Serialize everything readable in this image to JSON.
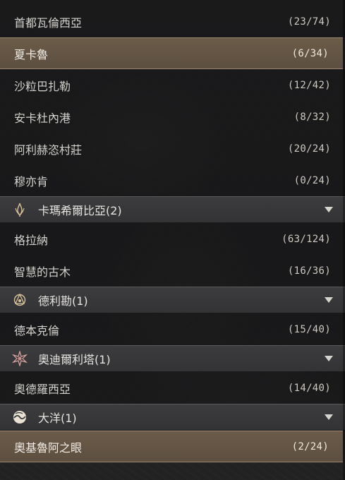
{
  "groups": [
    {
      "header": null,
      "items": [
        {
          "label": "首都瓦倫西亞",
          "count": "(23/74)",
          "selected": false
        },
        {
          "label": "夏卡魯",
          "count": "(6/34)",
          "selected": true
        },
        {
          "label": "沙粒巴扎勒",
          "count": "(12/42)",
          "selected": false
        },
        {
          "label": "安卡杜內港",
          "count": "(8/32)",
          "selected": false
        },
        {
          "label": "阿利赫恣村莊",
          "count": "(20/24)",
          "selected": false
        },
        {
          "label": "穆亦肯",
          "count": "(0/24)",
          "selected": false
        }
      ]
    },
    {
      "header": {
        "label": "卡瑪希爾比亞(2)",
        "icon": "kamasylvia-emblem-icon"
      },
      "items": [
        {
          "label": "格拉納",
          "count": "(63/124)",
          "selected": false
        },
        {
          "label": "智慧的古木",
          "count": "(16/36)",
          "selected": false
        }
      ]
    },
    {
      "header": {
        "label": "德利勘(1)",
        "icon": "drieghan-emblem-icon"
      },
      "items": [
        {
          "label": "德本克倫",
          "count": "(15/40)",
          "selected": false
        }
      ]
    },
    {
      "header": {
        "label": "奧迪爾利塔(1)",
        "icon": "odyllita-emblem-icon"
      },
      "items": [
        {
          "label": "奧德羅西亞",
          "count": "(14/40)",
          "selected": false
        }
      ]
    },
    {
      "header": {
        "label": "大洋(1)",
        "icon": "ocean-emblem-icon"
      },
      "items": [
        {
          "label": "奧基魯阿之眼",
          "count": "(2/24)",
          "selected": true
        }
      ]
    }
  ],
  "colors": {
    "accent_selected": "#5d4f40",
    "header_bg": "#36363a",
    "text": "#d4d2cc"
  }
}
